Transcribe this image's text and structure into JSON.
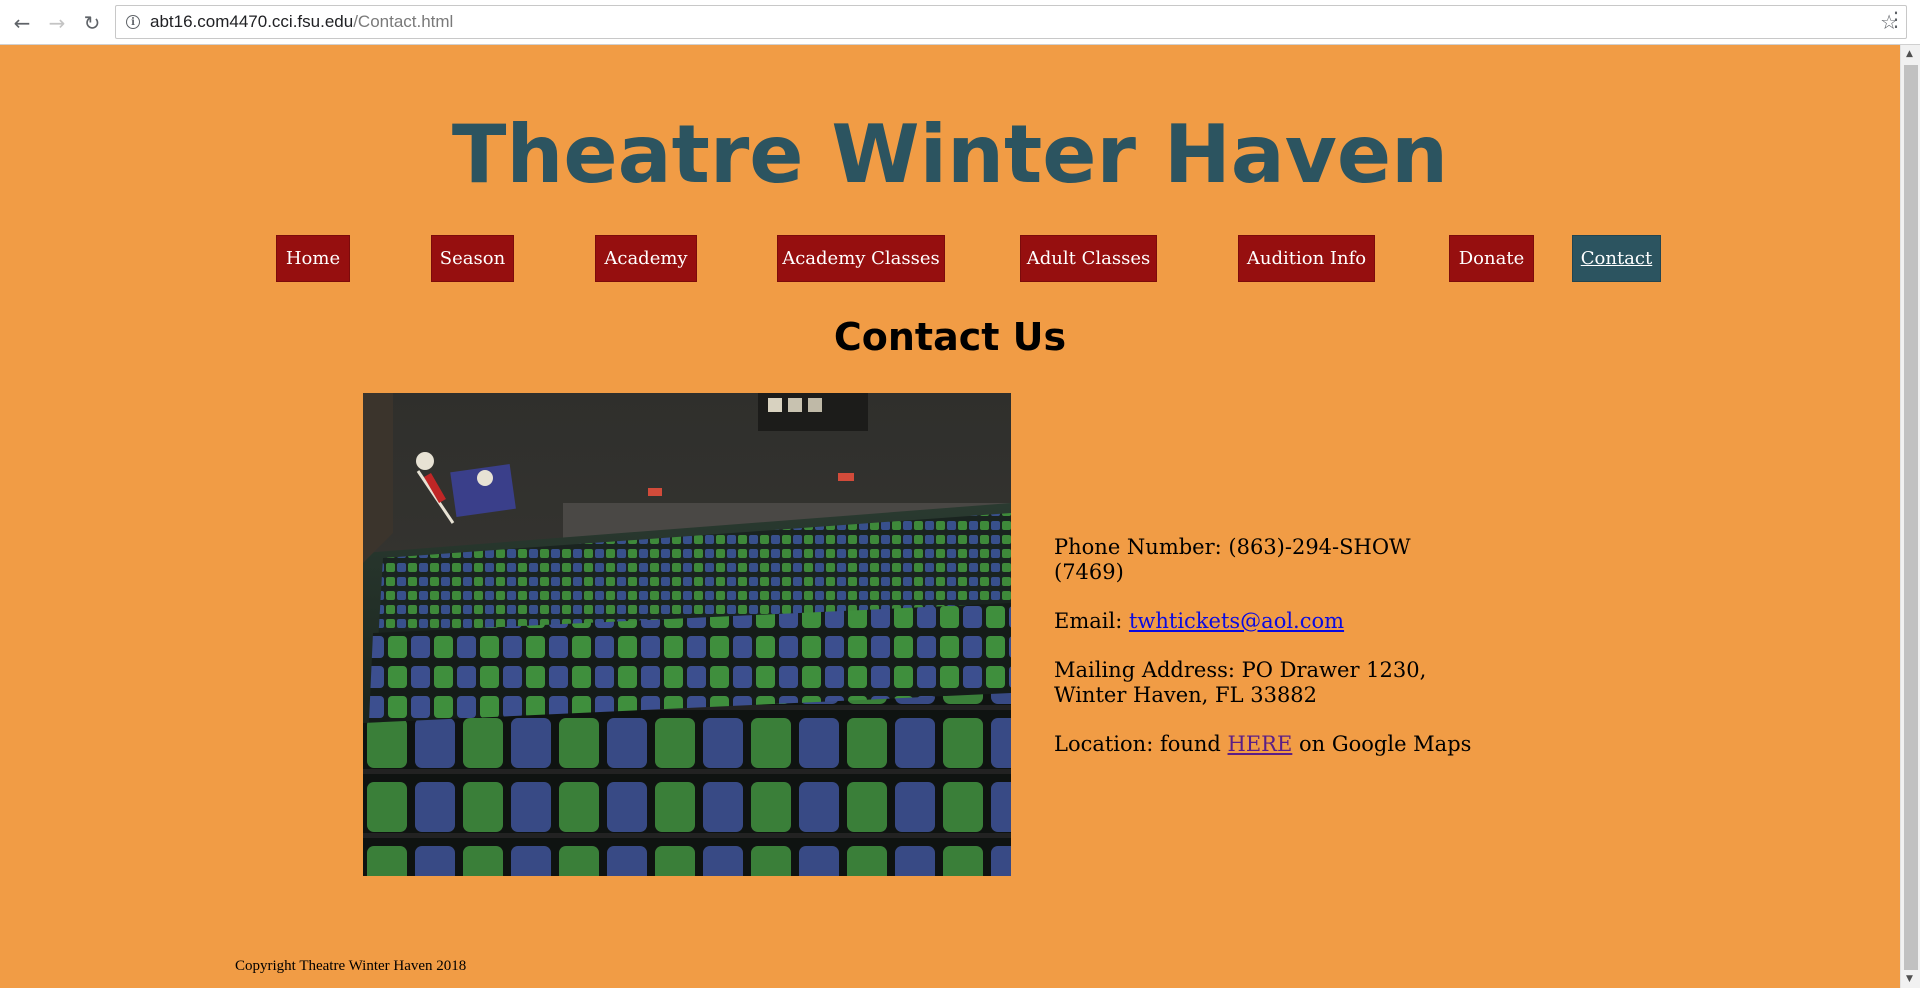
{
  "browser": {
    "url_domain": "abt16.com4470.cci.fsu.edu",
    "url_path": "/Contact.html"
  },
  "site": {
    "title": "Theatre Winter Haven"
  },
  "nav": {
    "items": [
      {
        "label": "Home"
      },
      {
        "label": "Season"
      },
      {
        "label": "Academy"
      },
      {
        "label": "Academy Classes"
      },
      {
        "label": "Adult Classes"
      },
      {
        "label": "Audition Info"
      },
      {
        "label": "Donate"
      },
      {
        "label": "Contact"
      }
    ],
    "active": "Contact"
  },
  "main": {
    "heading": "Contact Us",
    "phone_prefix": "Phone Number: (863)-294-SHOW (7469)",
    "email_prefix": "Email: ",
    "email_link": "twhtickets@aol.com",
    "address": "Mailing Address: PO Drawer 1230, Winter Haven, FL 33882",
    "location_prefix": "Location: found ",
    "location_link": "HERE",
    "location_suffix": " on Google Maps"
  },
  "footer": {
    "copyright": "Copyright Theatre Winter Haven 2018"
  },
  "colors": {
    "page_bg": "#f19c45",
    "title": "#2c5460",
    "nav_bg": "#960f0f",
    "nav_active_bg": "#2c5460"
  }
}
